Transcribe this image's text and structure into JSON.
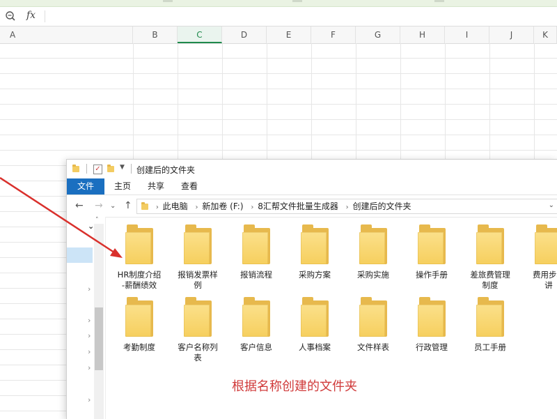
{
  "spreadsheet": {
    "formula_bar": {
      "fx_label": "fx"
    },
    "columns": [
      "A",
      "B",
      "C",
      "D",
      "E",
      "F",
      "G",
      "H",
      "I",
      "J",
      "K"
    ],
    "active_column": "C"
  },
  "explorer": {
    "title": "创建后的文件夹",
    "ribbon_tabs": [
      "文件",
      "主页",
      "共享",
      "查看"
    ],
    "breadcrumb": [
      "此电脑",
      "新加卷 (F:)",
      "8汇帮文件批量生成器",
      "创建后的文件夹"
    ],
    "folders_row1": [
      "HR制度介绍\n-薪酬绩效",
      "报销发票样\n例",
      "报销流程",
      "采购方案",
      "采购实施",
      "操作手册",
      "差旅费管理\n制度",
      "费用步骤\n讲"
    ],
    "folders_row2": [
      "考勤制度",
      "客户名称列\n表",
      "客户信息",
      "人事档案",
      "文件样表",
      "行政管理",
      "员工手册"
    ]
  },
  "annotation": {
    "text": "根据名称创建的文件夹",
    "color": "#d03a3a"
  },
  "colors": {
    "accent_green": "#1f8a4c",
    "ribbon_blue": "#1a6fc0",
    "folder_yellow": "#f6cf5e"
  }
}
